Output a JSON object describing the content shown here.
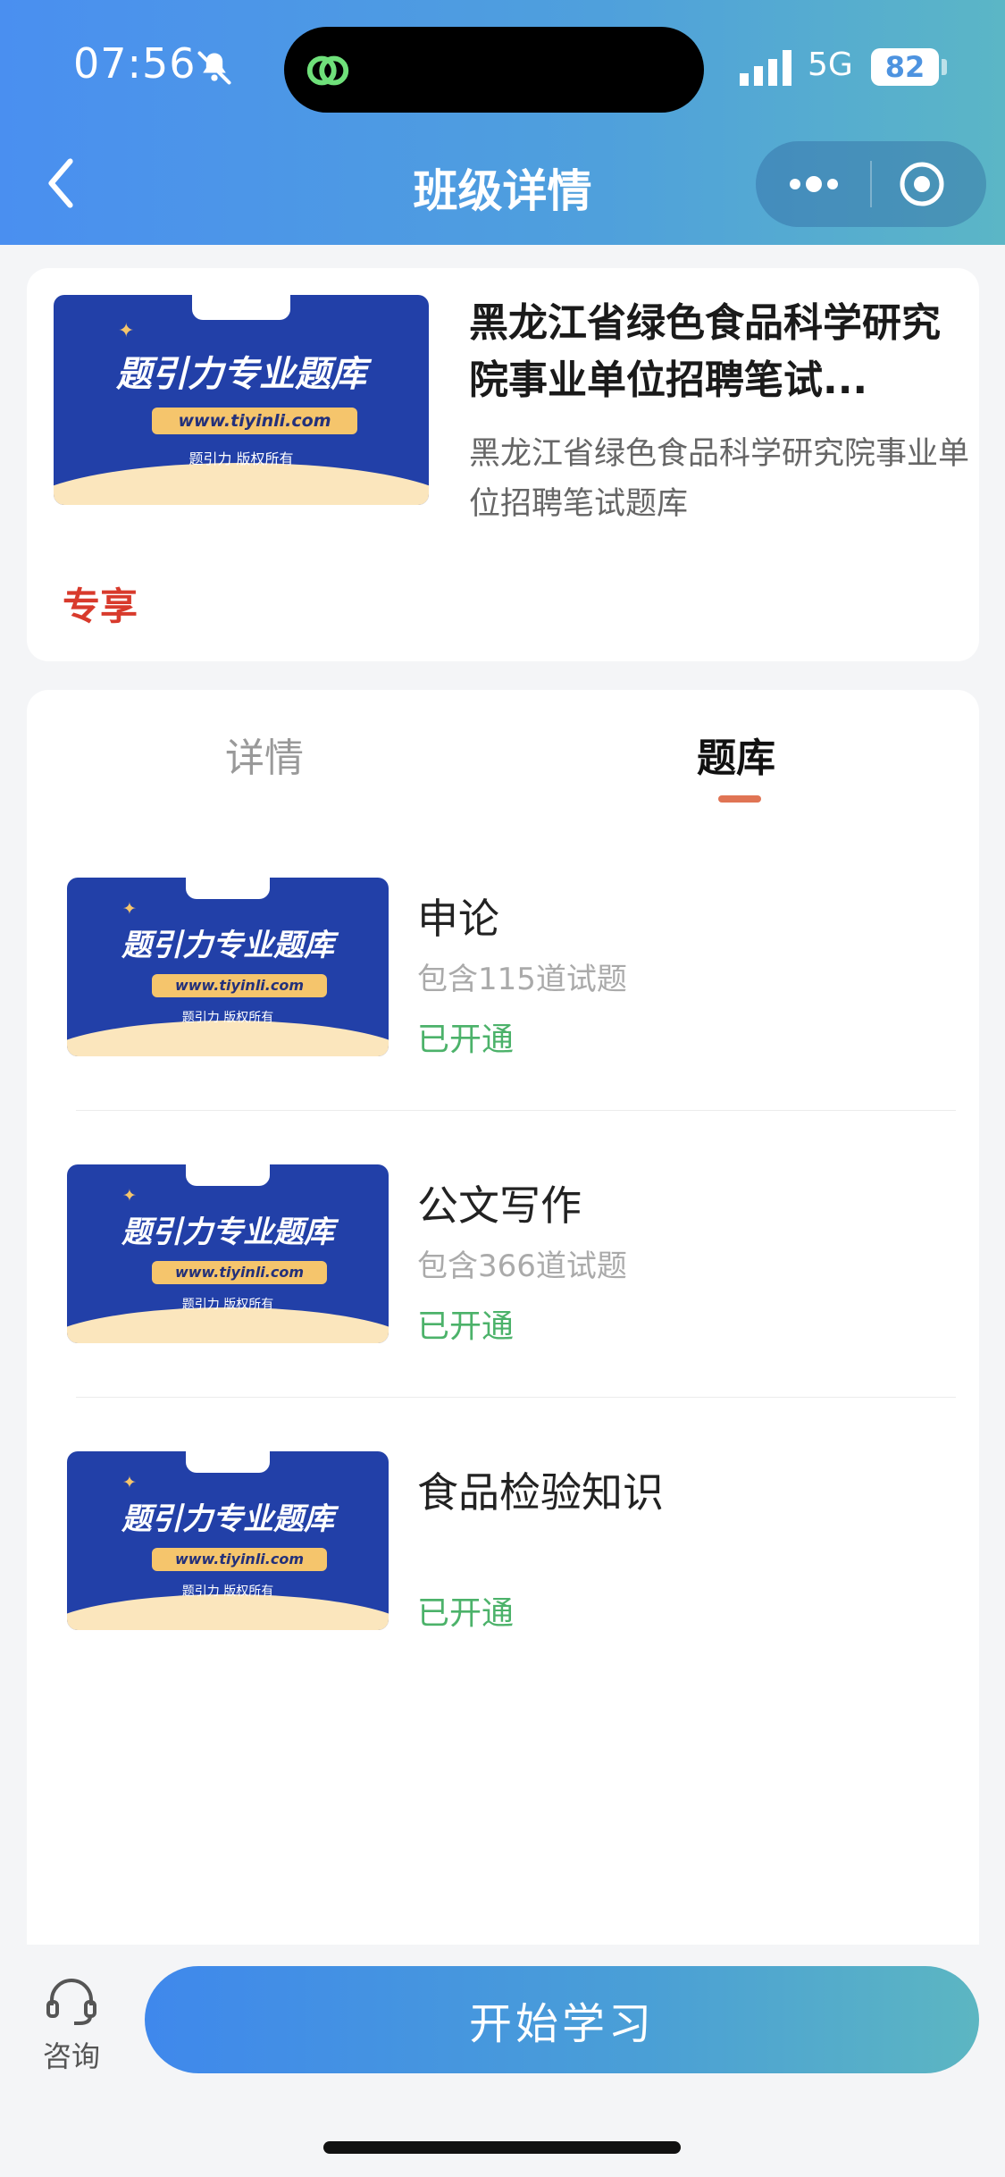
{
  "status_bar": {
    "time": "07:56",
    "network": "5G",
    "battery": "82"
  },
  "nav": {
    "title": "班级详情"
  },
  "course": {
    "title": "黑龙江省绿色食品科学研究院事业单位招聘笔试...",
    "description": "黑龙江省绿色食品科学研究院事业单位招聘笔试题库",
    "badge": "专享"
  },
  "banner": {
    "title": "题引力专业题库",
    "url": "www.tiyinli.com",
    "copyright": "题引力 版权所有"
  },
  "tabs": [
    {
      "label": "详情",
      "active": false
    },
    {
      "label": "题库",
      "active": true
    }
  ],
  "question_banks": [
    {
      "name": "申论",
      "count": "包含115道试题",
      "status": "已开通"
    },
    {
      "name": "公文写作",
      "count": "包含366道试题",
      "status": "已开通"
    },
    {
      "name": "食品检验知识",
      "count": "",
      "status": "已开通"
    }
  ],
  "bottom_bar": {
    "consult_label": "咨询",
    "start_label": "开始学习"
  },
  "colors": {
    "accent_blue": "#4a8ff0",
    "teal": "#5bb6c6",
    "badge_red": "#d83a2c",
    "status_green": "#4cb26a",
    "tab_indicator": "#e07454"
  }
}
